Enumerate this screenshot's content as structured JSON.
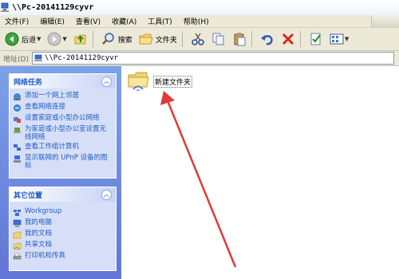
{
  "window": {
    "title": "\\\\Pc-20141129cyvr"
  },
  "menu": [
    "文件(F)",
    "编辑(E)",
    "查看(V)",
    "收藏(A)",
    "工具(T)",
    "帮助(H)"
  ],
  "toolbar": {
    "back_label": "后退",
    "search_label": "搜索",
    "folders_label": "文件夹"
  },
  "address": {
    "label": "地址(D)",
    "value": "\\\\Pc-20141129cyvr"
  },
  "network_tasks": {
    "title": "网络任务",
    "items": [
      {
        "label": "添加一个网上邻居",
        "icon": "add-network-place-icon"
      },
      {
        "label": "查看网络连接",
        "icon": "network-connections-icon"
      },
      {
        "label": "设置家庭或小型办公网络",
        "icon": "home-network-setup-icon"
      },
      {
        "label": "为家庭或小型办公室设置无线网络",
        "icon": "wireless-network-icon"
      },
      {
        "label": "查看工作组计算机",
        "icon": "workgroup-computers-icon"
      },
      {
        "label": "显示联网的 UPnP 设备的图标",
        "icon": "upnp-devices-icon"
      }
    ]
  },
  "other_places": {
    "title": "其它位置",
    "items": [
      {
        "label": "Workgroup",
        "icon": "workgroup-icon"
      },
      {
        "label": "我的电脑",
        "icon": "my-computer-icon"
      },
      {
        "label": "我的文档",
        "icon": "my-documents-icon"
      },
      {
        "label": "共享文档",
        "icon": "shared-documents-icon"
      },
      {
        "label": "打印机和传真",
        "icon": "printers-fax-icon"
      }
    ]
  },
  "content": {
    "items": [
      {
        "name": "新建文件夹",
        "icon": "shared-folder-icon"
      }
    ]
  },
  "colors": {
    "task_pane_top": "#7ba2e7",
    "task_pane_bottom": "#6375d6",
    "link_blue": "#215dc6",
    "annotation_arrow": "#e03a3a"
  }
}
